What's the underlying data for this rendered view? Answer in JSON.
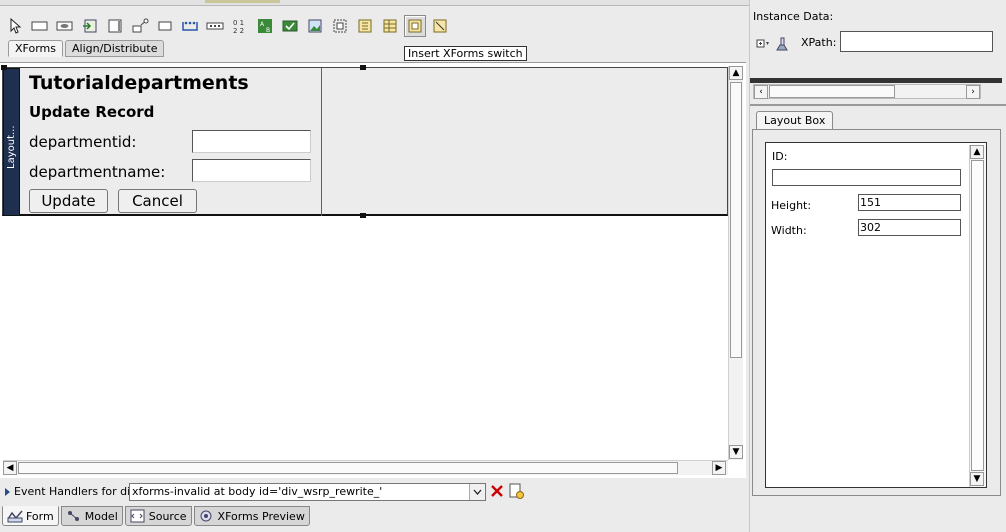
{
  "palette": {
    "tabs": [
      {
        "label": "XForms"
      },
      {
        "label": "Align/Distribute"
      }
    ],
    "tooltip": "Insert XForms switch",
    "tools": [
      "select-pointer-icon",
      "input-field-icon",
      "secret-field-icon",
      "upload-icon",
      "textarea-icon",
      "trigger-icon",
      "output-icon",
      "select1-icon",
      "select-icon",
      "range-icon",
      "submit-icon",
      "checkbox-icon",
      "image-icon",
      "group-icon",
      "repeat-icon",
      "table-icon",
      "switch-icon",
      "case-icon"
    ]
  },
  "form": {
    "layout_tab_label": "Layout...",
    "title": "Tutorialdepartments",
    "subtitle": "Update Record",
    "fields": [
      {
        "label": "departmentid:",
        "value": ""
      },
      {
        "label": "departmentname:",
        "value": ""
      }
    ],
    "buttons": {
      "update": "Update",
      "cancel": "Cancel"
    }
  },
  "events": {
    "label": "Event Handlers for div",
    "selected": "xforms-invalid at body id='div_wsrp_rewrite_'"
  },
  "bottom_tabs": [
    {
      "label": "Form",
      "icon": "form-icon"
    },
    {
      "label": "Model",
      "icon": "model-icon"
    },
    {
      "label": "Source",
      "icon": "source-icon"
    },
    {
      "label": "XForms Preview",
      "icon": "preview-icon"
    }
  ],
  "instance": {
    "title": "Instance Data:",
    "xpath_label": "XPath:",
    "xpath_value": ""
  },
  "layout_box": {
    "tab_label": "Layout Box",
    "id_label": "ID:",
    "id_value": "",
    "height_label": "Height:",
    "height_value": "151",
    "width_label": "Width:",
    "width_value": "302"
  },
  "colors": {
    "vertical_tab": "#1e2f50",
    "guide_line": "#cc3333",
    "delete_icon": "#cc0000"
  }
}
